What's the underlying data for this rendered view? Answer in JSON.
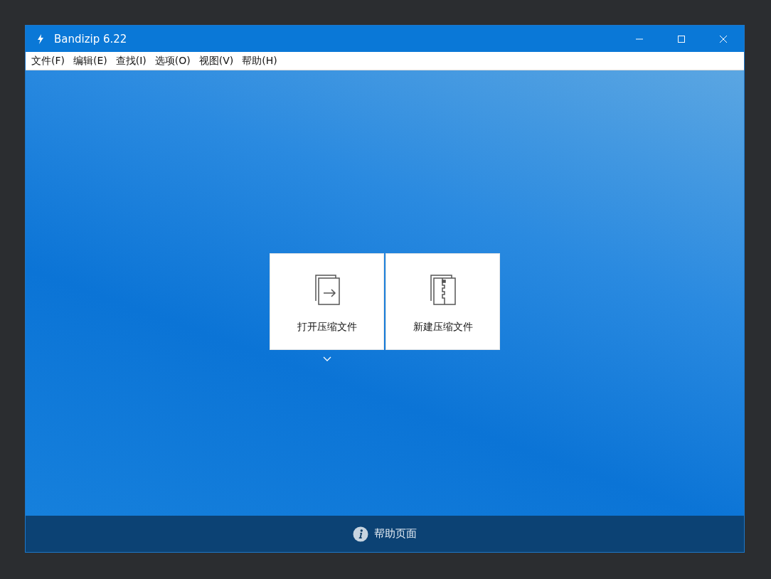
{
  "window": {
    "title": "Bandizip 6.22"
  },
  "menu": [
    {
      "label": "文件(F)"
    },
    {
      "label": "编辑(E)"
    },
    {
      "label": "查找(I)"
    },
    {
      "label": "选项(O)"
    },
    {
      "label": "视图(V)"
    },
    {
      "label": "帮助(H)"
    }
  ],
  "actions": [
    {
      "kind": "open",
      "label": "打开压缩文件",
      "dropdown": true
    },
    {
      "kind": "new",
      "label": "新建压缩文件",
      "dropdown": false
    }
  ],
  "footer": {
    "label": "帮助页面"
  }
}
